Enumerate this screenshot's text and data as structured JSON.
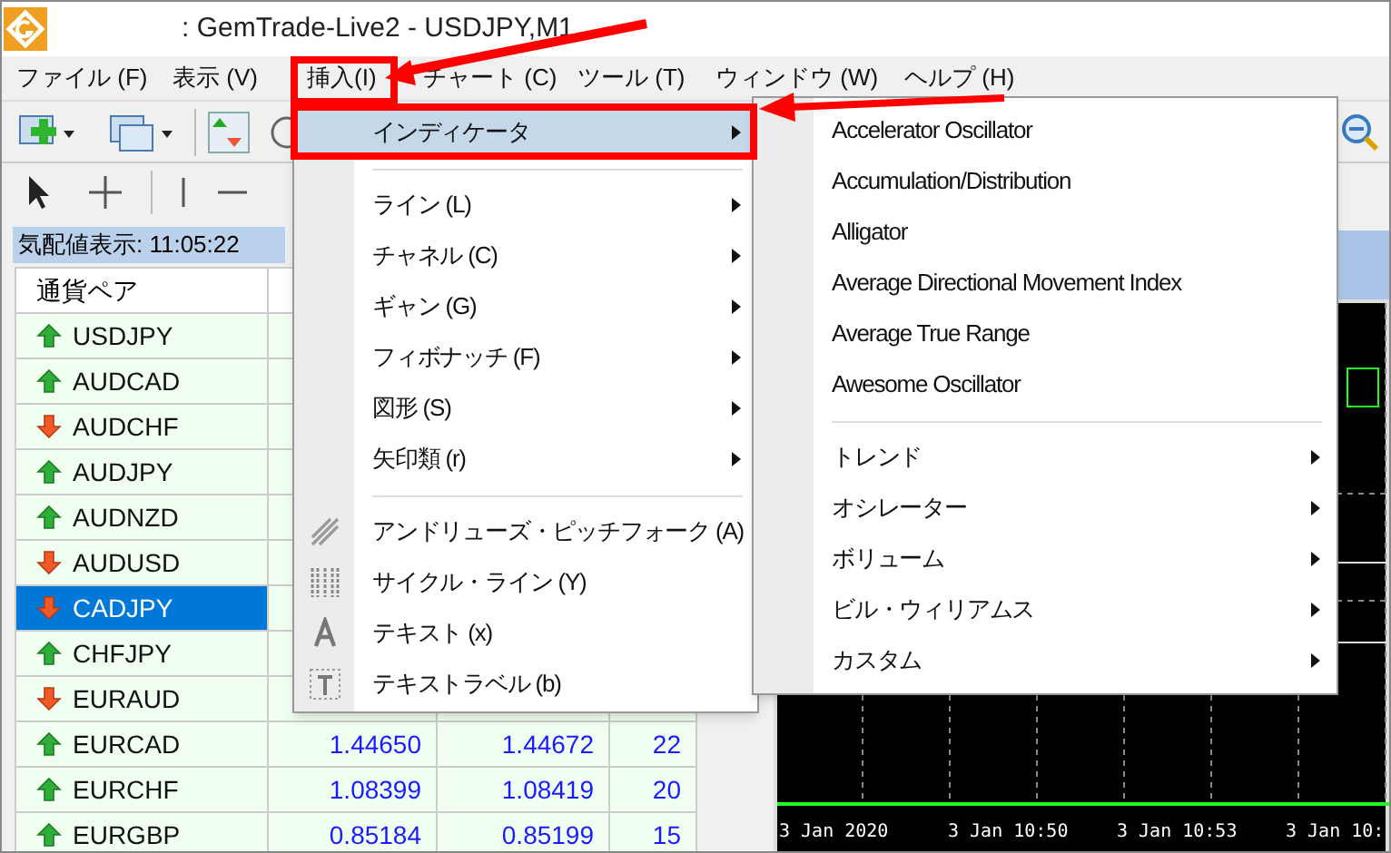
{
  "window": {
    "title": ": GemTrade-Live2 - USDJPY,M1"
  },
  "menubar": [
    {
      "label": "ファイル (F)"
    },
    {
      "label": "表示 (V)"
    },
    {
      "label": "挿入(I)"
    },
    {
      "label": "チャート (C)"
    },
    {
      "label": "ツール (T)"
    },
    {
      "label": "ウィンドウ (W)"
    },
    {
      "label": "ヘルプ (H)"
    }
  ],
  "market_watch": {
    "title": "気配値表示: 11:05:22",
    "columns": [
      "通貨ペア"
    ],
    "rows": [
      {
        "symbol": "USDJPY",
        "kind": "up",
        "selected": false
      },
      {
        "symbol": "AUDCAD",
        "kind": "up",
        "selected": false
      },
      {
        "symbol": "AUDCHF",
        "kind": "down",
        "selected": false
      },
      {
        "symbol": "AUDJPY",
        "kind": "up",
        "selected": false
      },
      {
        "symbol": "AUDNZD",
        "kind": "up",
        "selected": false
      },
      {
        "symbol": "AUDUSD",
        "kind": "down",
        "selected": false
      },
      {
        "symbol": "CADJPY",
        "kind": "down",
        "selected": true
      },
      {
        "symbol": "CHFJPY",
        "kind": "up",
        "selected": false
      },
      {
        "symbol": "EURAUD",
        "kind": "down",
        "selected": false
      },
      {
        "symbol": "EURCAD",
        "kind": "up",
        "selected": false,
        "bid": "1.44650",
        "ask": "1.44672",
        "spread": "22"
      },
      {
        "symbol": "EURCHF",
        "kind": "up",
        "selected": false,
        "bid": "1.08399",
        "ask": "1.08419",
        "spread": "20"
      },
      {
        "symbol": "EURGBP",
        "kind": "up",
        "selected": false,
        "bid": "0.85184",
        "ask": "0.85199",
        "spread": "15"
      }
    ]
  },
  "chart": {
    "time_labels": [
      "3 Jan 2020",
      "3 Jan 10:50",
      "3 Jan 10:53",
      "3 Jan 10:"
    ]
  },
  "insert_menu": [
    {
      "kind": "submenu",
      "label": "インディケータ",
      "selected": true
    },
    {
      "kind": "separator"
    },
    {
      "kind": "submenu",
      "label": "ライン (L)",
      "selected": false
    },
    {
      "kind": "submenu",
      "label": "チャネル (C)",
      "selected": false
    },
    {
      "kind": "submenu",
      "label": "ギャン (G)",
      "selected": false
    },
    {
      "kind": "submenu",
      "label": "フィボナッチ (F)",
      "selected": false
    },
    {
      "kind": "submenu",
      "label": "図形 (S)",
      "selected": false
    },
    {
      "kind": "submenu",
      "label": "矢印類 (r)",
      "selected": false
    },
    {
      "kind": "separator"
    },
    {
      "kind": "tool",
      "label": "アンドリューズ・ピッチフォーク (A)",
      "selected": false
    },
    {
      "kind": "tool",
      "label": "サイクル・ライン (Y)",
      "selected": false
    },
    {
      "kind": "tool",
      "label": "テキスト (x)",
      "selected": false
    },
    {
      "kind": "tool",
      "label": "テキストラベル (b)",
      "selected": false
    }
  ],
  "indicator_menu": [
    {
      "kind": "item",
      "label": "Accelerator Oscillator"
    },
    {
      "kind": "item",
      "label": "Accumulation/Distribution"
    },
    {
      "kind": "item",
      "label": "Alligator"
    },
    {
      "kind": "item",
      "label": "Average Directional Movement Index"
    },
    {
      "kind": "item",
      "label": "Average True Range"
    },
    {
      "kind": "item",
      "label": "Awesome Oscillator"
    },
    {
      "kind": "separator"
    },
    {
      "kind": "submenu",
      "label": "トレンド"
    },
    {
      "kind": "submenu",
      "label": "オシレーター"
    },
    {
      "kind": "submenu",
      "label": "ボリューム"
    },
    {
      "kind": "submenu",
      "label": "ビル・ウィリアムス"
    },
    {
      "kind": "submenu",
      "label": "カスタム"
    }
  ]
}
